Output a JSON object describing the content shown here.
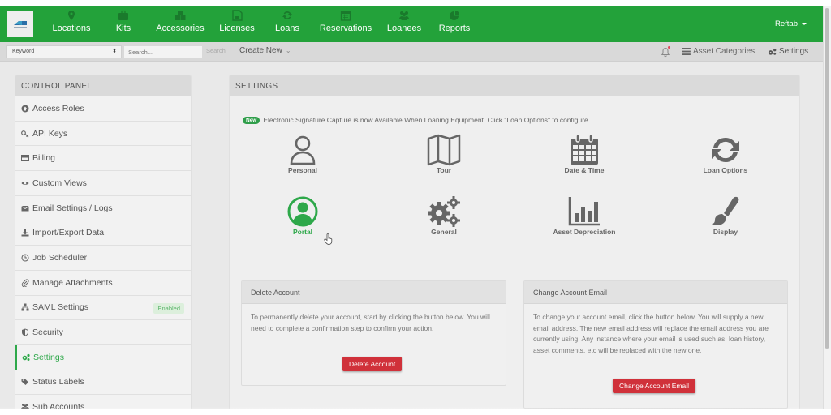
{
  "topnav": {
    "items": [
      {
        "label": "Locations",
        "icon": "map-marker-icon"
      },
      {
        "label": "Kits",
        "icon": "briefcase-icon"
      },
      {
        "label": "Accessories",
        "icon": "cubes-icon"
      },
      {
        "label": "Licenses",
        "icon": "floppy-disk-icon"
      },
      {
        "label": "Loans",
        "icon": "refresh-icon"
      },
      {
        "label": "Reservations",
        "icon": "calendar-icon"
      },
      {
        "label": "Loanees",
        "icon": "users-icon"
      },
      {
        "label": "Reports",
        "icon": "pie-chart-icon"
      }
    ],
    "user_label": "Reftab"
  },
  "subbar": {
    "keyword_select": "Keyword",
    "search_placeholder": "Search...",
    "search_button": "Search",
    "create_new": "Create New",
    "asset_categories": "Asset Categories",
    "settings": "Settings"
  },
  "sidebar": {
    "title": "CONTROL PANEL",
    "items": [
      {
        "label": "Access Roles",
        "icon": "arrow-circle-up-icon"
      },
      {
        "label": "API Keys",
        "icon": "key-icon"
      },
      {
        "label": "Billing",
        "icon": "credit-card-icon"
      },
      {
        "label": "Custom Views",
        "icon": "eye-icon"
      },
      {
        "label": "Email Settings / Logs",
        "icon": "envelope-icon"
      },
      {
        "label": "Import/Export Data",
        "icon": "download-icon"
      },
      {
        "label": "Job Scheduler",
        "icon": "clock-icon"
      },
      {
        "label": "Manage Attachments",
        "icon": "paperclip-icon"
      },
      {
        "label": "SAML Settings",
        "icon": "sitemap-icon",
        "badge": "Enabled"
      },
      {
        "label": "Security",
        "icon": "shield-icon"
      },
      {
        "label": "Settings",
        "icon": "cogs-icon",
        "active": true
      },
      {
        "label": "Status Labels",
        "icon": "tags-icon"
      },
      {
        "label": "Sub Accounts",
        "icon": "users-icon"
      }
    ]
  },
  "main": {
    "title": "SETTINGS",
    "notice_badge": "New",
    "notice_text": "Electronic Signature Capture is now Available When Loaning Equipment. Click \"Loan Options\" to configure.",
    "tiles": [
      {
        "label": "Personal",
        "icon": "user-icon"
      },
      {
        "label": "Tour",
        "icon": "map-icon"
      },
      {
        "label": "Date & Time",
        "icon": "calendar-icon"
      },
      {
        "label": "Loan Options",
        "icon": "refresh-icon"
      },
      {
        "label": "Portal",
        "icon": "user-circle-icon",
        "active": true
      },
      {
        "label": "General",
        "icon": "cogs-icon"
      },
      {
        "label": "Asset Depreciation",
        "icon": "bar-chart-icon"
      },
      {
        "label": "Display",
        "icon": "paint-brush-icon"
      }
    ],
    "delete_card": {
      "title": "Delete Account",
      "body": "To permanently delete your account, start by clicking the button below. You will need to complete a confirmation step to confirm your action.",
      "button": "Delete Account"
    },
    "email_card": {
      "title": "Change Account Email",
      "body": "To change your account email, click the button below. You will supply a new email address. The new email address will replace the email address you are currently using. Any instance where your email is used such as, loan history, asset comments, etc will be replaced with the new one.",
      "button": "Change Account Email"
    }
  },
  "colors": {
    "brand_green": "#23a23a",
    "active_green": "#2ea84a",
    "danger_red": "#d0313a"
  }
}
